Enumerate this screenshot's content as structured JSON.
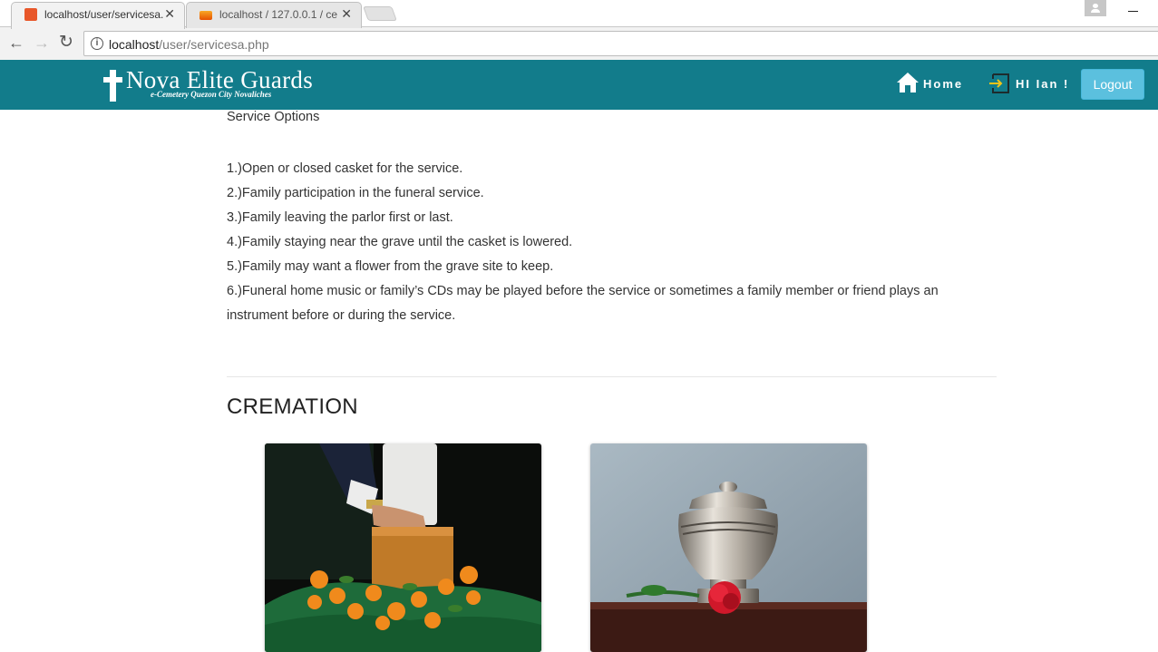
{
  "browser": {
    "tabs": [
      {
        "title": "localhost/user/servicesa.p",
        "active": true
      },
      {
        "title": "localhost / 127.0.0.1 / ce",
        "active": false
      }
    ],
    "url_host": "localhost",
    "url_path": "/user/servicesa.php"
  },
  "header": {
    "logo_name": "Nova Elite Guards",
    "logo_tagline": "e-Cemetery Quezon City Novaliches",
    "home_label": "Home",
    "greeting": "HI Ian !",
    "logout_label": "Logout",
    "color": "#127c8b"
  },
  "content": {
    "options_title": "Service Options",
    "options": [
      "1.)Open or closed casket for the service.",
      "2.)Family participation in the funeral service.",
      "3.)Family leaving the parlor first or last.",
      "4.)Family staying near the grave until the casket is lowered.",
      "5.)Family may want a flower from the grave site to keep.",
      "6.)Funeral home music or family’s CDs may be played before the service or sometimes a family member or friend plays an instrument before or during the service."
    ],
    "section_title": "CREMATION"
  }
}
